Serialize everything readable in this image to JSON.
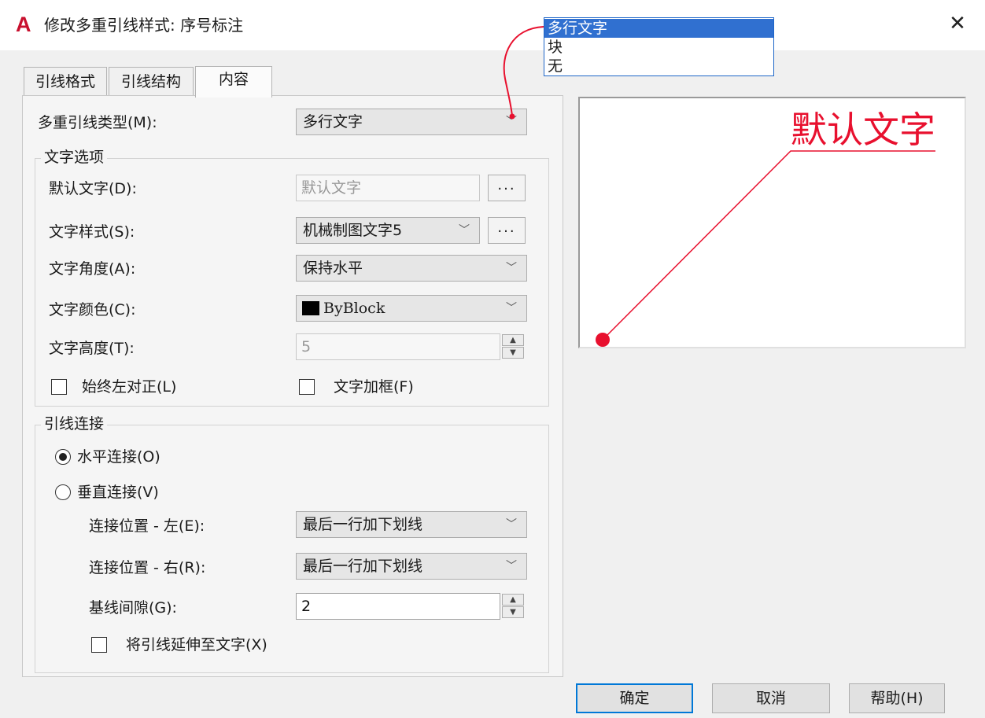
{
  "window": {
    "app_logo": "A",
    "title": "修改多重引线样式: 序号标注",
    "close_symbol": "✕"
  },
  "tabs": [
    {
      "label": "引线格式",
      "active": false
    },
    {
      "label": "引线结构",
      "active": false
    },
    {
      "label": "内容",
      "active": true
    }
  ],
  "content": {
    "leader_type": {
      "label": "多重引线类型(M):",
      "value": "多行文字"
    },
    "text_options": {
      "title": "文字选项",
      "default_text": {
        "label": "默认文字(D):",
        "value": "默认文字",
        "button": "..."
      },
      "text_style": {
        "label": "文字样式(S):",
        "value": "机械制图文字5",
        "button": "..."
      },
      "text_angle": {
        "label": "文字角度(A):",
        "value": "保持水平"
      },
      "text_color": {
        "label": "文字颜色(C):",
        "value": "ByBlock",
        "swatch_color": "#000000"
      },
      "text_height": {
        "label": "文字高度(T):",
        "value": "5"
      },
      "always_left_justify": {
        "label": "始终左对正(L)",
        "checked": false
      },
      "frame_text": {
        "label": "文字加框(F)",
        "checked": false
      }
    },
    "leader_connection": {
      "title": "引线连接",
      "horizontal": {
        "label": "水平连接(O)",
        "selected": true
      },
      "vertical": {
        "label": "垂直连接(V)",
        "selected": false
      },
      "attach_left": {
        "label": "连接位置 - 左(E):",
        "value": "最后一行加下划线"
      },
      "attach_right": {
        "label": "连接位置 - 右(R):",
        "value": "最后一行加下划线"
      },
      "landing_gap": {
        "label": "基线间隙(G):",
        "value": "2"
      },
      "extend_leader": {
        "label": "将引线延伸至文字(X)",
        "checked": false
      }
    }
  },
  "dropdown_popup": {
    "options": [
      "多行文字",
      "块",
      "无"
    ],
    "selected_index": 0
  },
  "preview": {
    "text": "默认文字",
    "color": "#e8102e"
  },
  "buttons": {
    "ok": "确定",
    "cancel": "取消",
    "help": "帮助(H)"
  },
  "colors": {
    "accent": "#0078d7",
    "highlight": "#3070d0",
    "leader_red": "#e8102e",
    "logo_red": "#c8102e"
  }
}
